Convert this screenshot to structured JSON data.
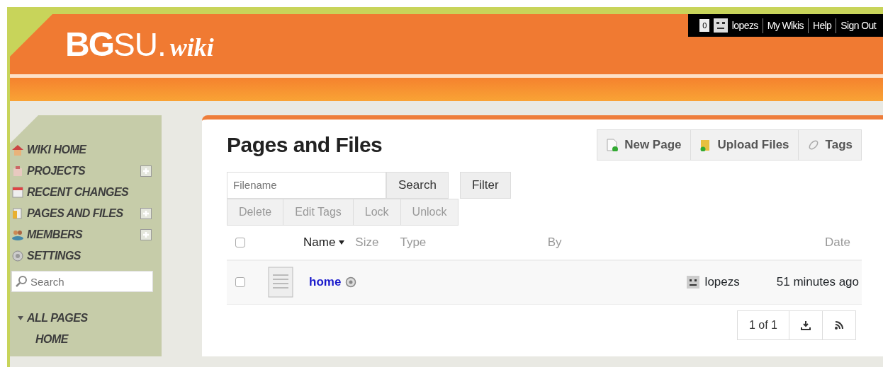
{
  "user_bar": {
    "notifications": "0",
    "user": "lopezs",
    "links": [
      "My Wikis",
      "Help",
      "Sign Out"
    ]
  },
  "logo": {
    "bold": "BG",
    "light": "SU.",
    "suffix": "wiki"
  },
  "sidebar": {
    "items": [
      {
        "kind": "home",
        "label": "WIKI HOME",
        "has_add": false
      },
      {
        "kind": "projects",
        "label": "PROJECTS",
        "has_add": true
      },
      {
        "kind": "changes",
        "label": "RECENT CHANGES",
        "has_add": false
      },
      {
        "kind": "pages",
        "label": "PAGES AND FILES",
        "has_add": true
      },
      {
        "kind": "members",
        "label": "MEMBERS",
        "has_add": true
      },
      {
        "kind": "settings",
        "label": "SETTINGS",
        "has_add": false
      }
    ],
    "search": {
      "placeholder": "Search"
    },
    "tree": [
      {
        "label": "ALL PAGES",
        "expanded": true,
        "children": [
          {
            "label": "HOME"
          }
        ]
      }
    ]
  },
  "main": {
    "title": "Pages and Files",
    "actions": [
      {
        "kind": "new",
        "label": "New Page"
      },
      {
        "kind": "upload",
        "label": "Upload Files"
      },
      {
        "kind": "tags",
        "label": "Tags"
      }
    ],
    "filename": {
      "placeholder": "Filename"
    },
    "search_button": "Search",
    "filter_button": "Filter",
    "bulk_buttons": [
      {
        "label": "Delete",
        "disabled": true
      },
      {
        "label": "Edit Tags",
        "disabled": true
      },
      {
        "label": "Lock",
        "disabled": true
      },
      {
        "label": "Unlock",
        "disabled": true
      }
    ],
    "table": {
      "select_all": false,
      "columns": [
        {
          "label": "Name",
          "sorted": true
        },
        {
          "label": "Size",
          "sorted": false
        },
        {
          "label": "Type",
          "sorted": false
        },
        {
          "label": "By",
          "sorted": false
        },
        {
          "label": "Date",
          "sorted": false
        }
      ],
      "rows": [
        {
          "name": "home",
          "checked": false,
          "by": "lopezs",
          "date": "51 minutes ago"
        }
      ]
    },
    "pager": "1 of 1"
  }
}
